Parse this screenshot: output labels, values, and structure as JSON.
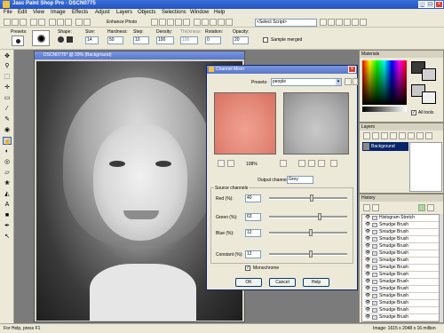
{
  "app": {
    "title": "Jasc Paint Shop Pro - DSCN0775"
  },
  "menu": [
    "File",
    "Edit",
    "View",
    "Image",
    "Effects",
    "Adjust",
    "Layers",
    "Objects",
    "Selections",
    "Window",
    "Help"
  ],
  "toolbar": {
    "enhance_label": "Enhance Photo",
    "script_select": "<Select Script>"
  },
  "options": {
    "presets_label": "Presets:",
    "shape_label": "Shape:",
    "size_label": "Size:",
    "size_value": "14",
    "hardness_label": "Hardness:",
    "hardness_value": "50",
    "step_label": "Step:",
    "step_value": "10",
    "density_label": "Density:",
    "density_value": "100",
    "thickness_label": "Thickness:",
    "thickness_value": "100",
    "rotation_label": "Rotation:",
    "rotation_value": "0",
    "opacity_label": "Opacity:",
    "opacity_value": "20",
    "sample_merged": "Sample merged"
  },
  "image_window": {
    "title": "DSCN0775* @ 29% (Background)"
  },
  "channel_mixer": {
    "title": "Channel Mixer",
    "presets_label": "Presets:",
    "presets_value": "people",
    "zoom_value": "108%",
    "output_label": "Output channel:",
    "output_value": "Grey",
    "source_group": "Source channels",
    "red_label": "Red (%):",
    "red_value": "40",
    "red_pct": 0.55,
    "green_label": "Green (%):",
    "green_value": "63",
    "green_pct": 0.65,
    "blue_label": "Blue (%):",
    "blue_value": "12",
    "blue_pct": 0.53,
    "constant_label": "Constant (%):",
    "constant_value": "12",
    "constant_pct": 0.53,
    "monochrome_label": "Monochrome",
    "ok_label": "OK",
    "cancel_label": "Cancel",
    "help_label": "Help"
  },
  "materials": {
    "title": "Materials",
    "all_tools": "All tools"
  },
  "layers": {
    "title": "Layers",
    "layer_name": "Background"
  },
  "history": {
    "title": "History",
    "items": [
      "Histogram Stretch",
      "Smudge Brush",
      "Smudge Brush",
      "Smudge Brush",
      "Smudge Brush",
      "Smudge Brush",
      "Smudge Brush",
      "Smudge Brush",
      "Smudge Brush",
      "Smudge Brush",
      "Smudge Brush",
      "Smudge Brush",
      "Smudge Brush",
      "Smudge Brush",
      "Smudge Brush",
      "Smudge Brush"
    ]
  },
  "status": {
    "left": "For Help, press F1",
    "right": "Image: 1615 x 2048 x 16 million"
  }
}
